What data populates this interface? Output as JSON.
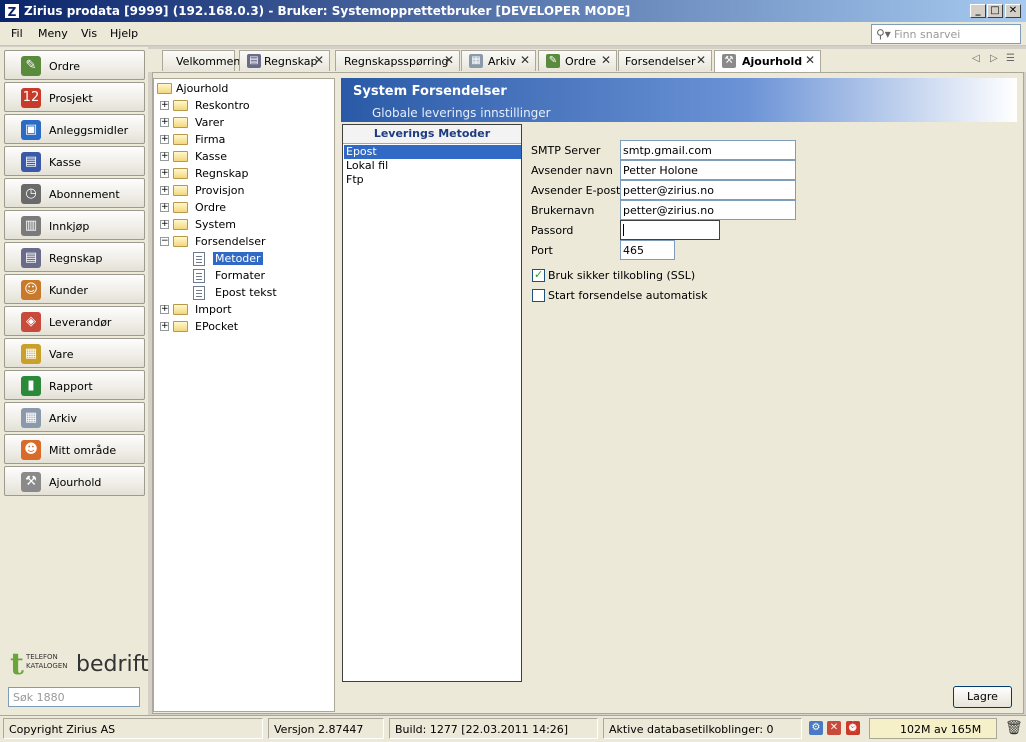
{
  "window": {
    "title": "Zirius prodata [9999] (192.168.0.3)  - Bruker: Systemopprettetbruker [DEVELOPER MODE]",
    "app_icon_glyph": "Z",
    "buttons": [
      "_",
      "□",
      "✕"
    ]
  },
  "menu": {
    "items": [
      "Fil",
      "Meny",
      "Vis",
      "Hjelp"
    ],
    "search_placeholder": "Finn snarvei"
  },
  "nav": {
    "items": [
      {
        "label": "Ordre",
        "icon": "order-icon",
        "color": "#5a8a3c"
      },
      {
        "label": "Prosjekt",
        "icon": "calendar-icon",
        "color": "#c83a2a"
      },
      {
        "label": "Anleggsmidler",
        "icon": "assets-icon",
        "color": "#2a6cc4"
      },
      {
        "label": "Kasse",
        "icon": "cash-register-icon",
        "color": "#3a5aa8"
      },
      {
        "label": "Abonnement",
        "icon": "clock-icon",
        "color": "#6a6a6a"
      },
      {
        "label": "Innkjøp",
        "icon": "purchase-icon",
        "color": "#7a7a7a"
      },
      {
        "label": "Regnskap",
        "icon": "accounting-icon",
        "color": "#6a6a8a"
      },
      {
        "label": "Kunder",
        "icon": "customers-icon",
        "color": "#c87a2a"
      },
      {
        "label": "Leverandør",
        "icon": "supplier-icon",
        "color": "#c84a3a"
      },
      {
        "label": "Vare",
        "icon": "package-icon",
        "color": "#c8a02a"
      },
      {
        "label": "Rapport",
        "icon": "chart-icon",
        "color": "#2a8a3a"
      },
      {
        "label": "Arkiv",
        "icon": "archive-icon",
        "color": "#8a9aaa"
      },
      {
        "label": "Mitt område",
        "icon": "person-icon",
        "color": "#d86a2a"
      },
      {
        "label": "Ajourhold",
        "icon": "wrench-icon",
        "color": "#8a8a8a"
      }
    ],
    "logo": {
      "t": "t",
      "line1": "TELEFON",
      "line2": "KATALOGEN",
      "word": "bedrift"
    },
    "search_placeholder": "Søk 1880"
  },
  "tabs": {
    "items": [
      {
        "label": "Velkommen",
        "closable": false,
        "icon": ""
      },
      {
        "label": "Regnskap",
        "closable": true,
        "icon": "accounting-icon"
      },
      {
        "label": "Regnskapsspørring",
        "closable": true,
        "icon": ""
      },
      {
        "label": "Arkiv",
        "closable": true,
        "icon": "archive-icon"
      },
      {
        "label": "Ordre",
        "closable": true,
        "icon": "order-icon"
      },
      {
        "label": "Forsendelser",
        "closable": true,
        "icon": ""
      },
      {
        "label": "Ajourhold",
        "closable": true,
        "icon": "wrench-icon",
        "active": true
      }
    ],
    "close_glyph": "✕",
    "nav_glyphs": [
      "◁",
      "▷",
      "☰"
    ]
  },
  "tree": {
    "root": "Ajourhold",
    "nodes": [
      {
        "label": "Reskontro",
        "expander": "+"
      },
      {
        "label": "Varer",
        "expander": "+"
      },
      {
        "label": "Firma",
        "expander": "+"
      },
      {
        "label": "Kasse",
        "expander": "+"
      },
      {
        "label": "Regnskap",
        "expander": "+"
      },
      {
        "label": "Provisjon",
        "expander": "+"
      },
      {
        "label": "Ordre",
        "expander": "+"
      },
      {
        "label": "System",
        "expander": "+"
      },
      {
        "label": "Forsendelser",
        "expander": "−"
      }
    ],
    "children": [
      {
        "label": "Metoder",
        "selected": true
      },
      {
        "label": "Formater",
        "selected": false
      },
      {
        "label": "Epost tekst",
        "selected": false
      }
    ],
    "after": [
      {
        "label": "Import",
        "expander": "+"
      },
      {
        "label": "EPocket",
        "expander": "+"
      }
    ]
  },
  "panel": {
    "title": "System Forsendelser",
    "subtitle": "Globale leverings innstillinger",
    "methods_header": "Leverings Metoder",
    "methods": [
      {
        "label": "Epost",
        "selected": true
      },
      {
        "label": "Lokal fil",
        "selected": false
      },
      {
        "label": "Ftp",
        "selected": false
      }
    ],
    "fields": [
      {
        "label": "SMTP Server",
        "value": "smtp.gmail.com"
      },
      {
        "label": "Avsender navn",
        "value": "Petter Holone"
      },
      {
        "label": "Avsender E-post",
        "value": "petter@zirius.no"
      },
      {
        "label": "Brukernavn",
        "value": "petter@zirius.no"
      },
      {
        "label": "Passord",
        "value": ""
      },
      {
        "label": "Port",
        "value": "465"
      }
    ],
    "checkboxes": [
      {
        "label": "Bruk sikker tilkobling (SSL)",
        "checked": true
      },
      {
        "label": "Start forsendelse automatisk",
        "checked": false
      }
    ],
    "save_label": "Lagre"
  },
  "status": {
    "copyright": "Copyright Zirius AS",
    "version": "Versjon 2.87447",
    "build": "Build: 1277 [22.03.2011 14:26]",
    "db": "Aktive databasetilkoblinger: 0",
    "memory": "102M av 165M"
  }
}
